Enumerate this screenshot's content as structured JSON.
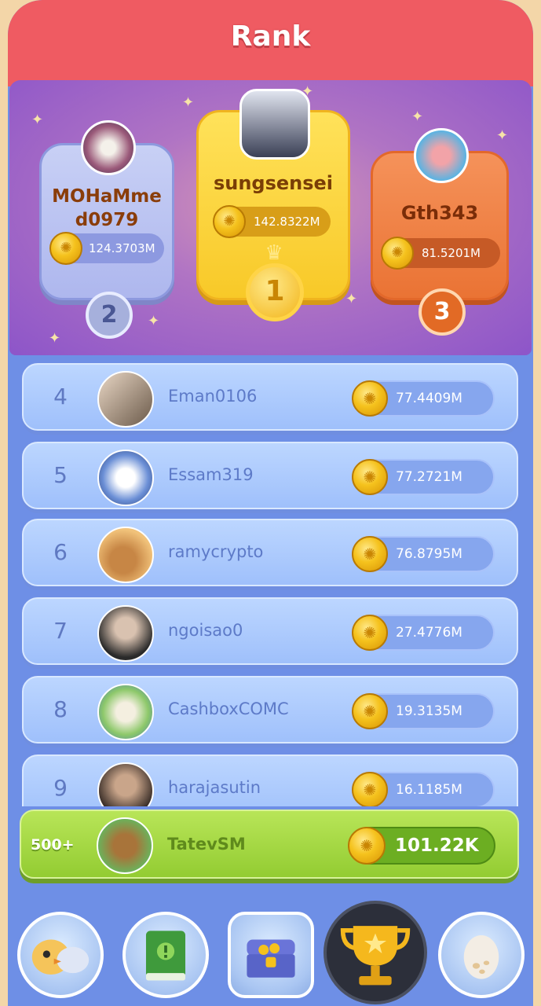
{
  "header": {
    "title": "Rank"
  },
  "top3": [
    {
      "rank": "2",
      "name": "MOHaMme d0979",
      "score": "124.3703M"
    },
    {
      "rank": "1",
      "name": "sungsensei",
      "score": "142.8322M"
    },
    {
      "rank": "3",
      "name": "Gth343",
      "score": "81.5201M"
    }
  ],
  "rows": [
    {
      "rank": "4",
      "name": "Eman0106",
      "score": "77.4409M"
    },
    {
      "rank": "5",
      "name": "Essam319",
      "score": "77.2721M"
    },
    {
      "rank": "6",
      "name": "ramycrypto",
      "score": "76.8795M"
    },
    {
      "rank": "7",
      "name": "ngoisao0",
      "score": "27.4776M"
    },
    {
      "rank": "8",
      "name": "CashboxCOMC",
      "score": "19.3135M"
    },
    {
      "rank": "9",
      "name": "harajasutin",
      "score": "16.1185M"
    }
  ],
  "me": {
    "rank": "500+",
    "name": "TatevSM",
    "score": "101.22K"
  },
  "nav": [
    {
      "icon": "bird-pets-icon"
    },
    {
      "icon": "book-icon"
    },
    {
      "icon": "treasure-chest-icon"
    },
    {
      "icon": "trophy-icon",
      "active": true
    },
    {
      "icon": "egg-icon"
    }
  ]
}
